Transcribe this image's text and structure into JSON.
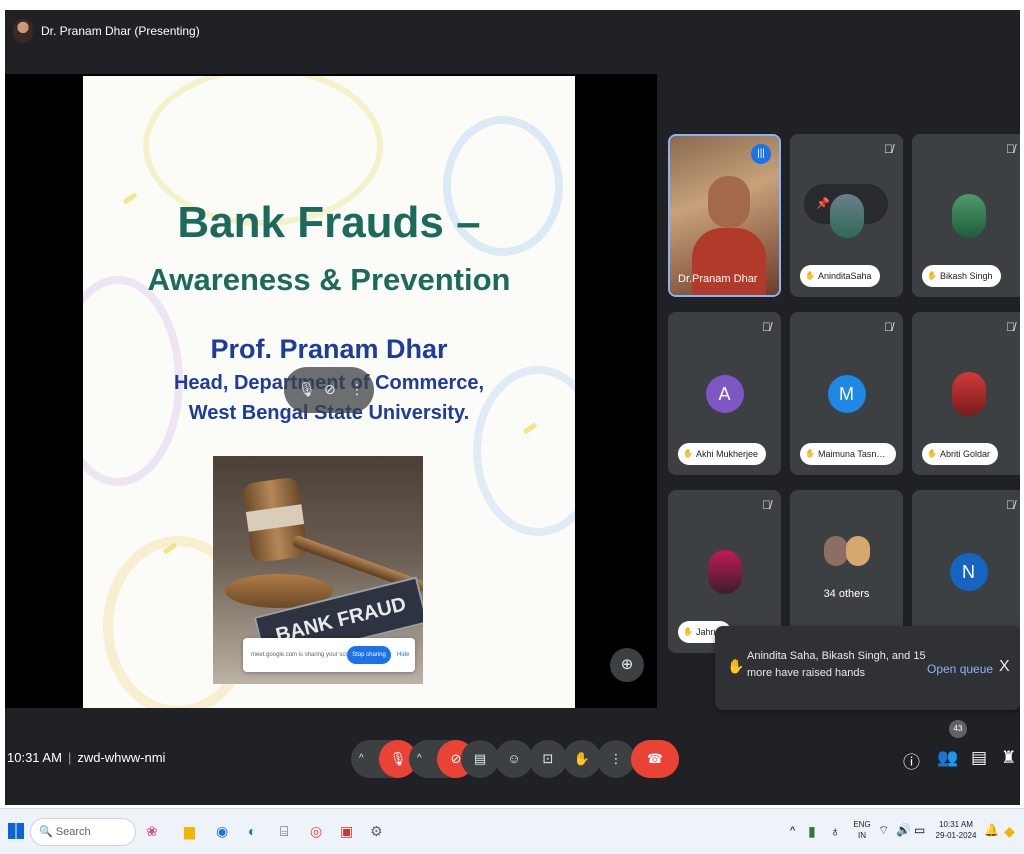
{
  "header": {
    "presenter_title": "Dr. Pranam Dhar (Presenting)"
  },
  "slide": {
    "title": "Bank Frauds –",
    "subtitle": "Awareness & Prevention",
    "author": "Prof. Pranam Dhar",
    "position": "Head, Department of Commerce,",
    "institution": "West Bengal State University.",
    "image_plate": "BANK FRAUD",
    "share_notice": "meet.google.com is sharing your screen.",
    "stop_sharing": "Stop sharing",
    "hide": "Hide"
  },
  "participants": [
    {
      "name": "Dr.Pranam Dhar",
      "kind": "self-video"
    },
    {
      "name": "AninditaSaha",
      "kind": "photo"
    },
    {
      "name": "Bikash Singh",
      "kind": "photo"
    },
    {
      "name": "Akhi Mukherjee",
      "kind": "initial",
      "initial": "A",
      "color": "#7e57c2"
    },
    {
      "name": "Maimuna Tasne...",
      "kind": "initial",
      "initial": "M",
      "color": "#1e88e5"
    },
    {
      "name": "Abriti Goldar",
      "kind": "photo"
    },
    {
      "name": "Jahn...",
      "kind": "photo"
    },
    {
      "name": "34 others",
      "kind": "group"
    },
    {
      "name": "",
      "kind": "initial",
      "initial": "N",
      "color": "#1565c0"
    }
  ],
  "notification": {
    "text": "Anindita Saha, Bikash Singh, and 15 more have raised hands",
    "open_queue": "Open queue",
    "close": "X"
  },
  "meeting": {
    "time": "10:31 AM",
    "code": "zwd-whww-nmi",
    "people_count": "43"
  },
  "taskbar": {
    "search": "Search",
    "lang_top": "ENG",
    "lang_bottom": "IN",
    "clock_time": "10:31 AM",
    "clock_date": "29-01-2024"
  }
}
